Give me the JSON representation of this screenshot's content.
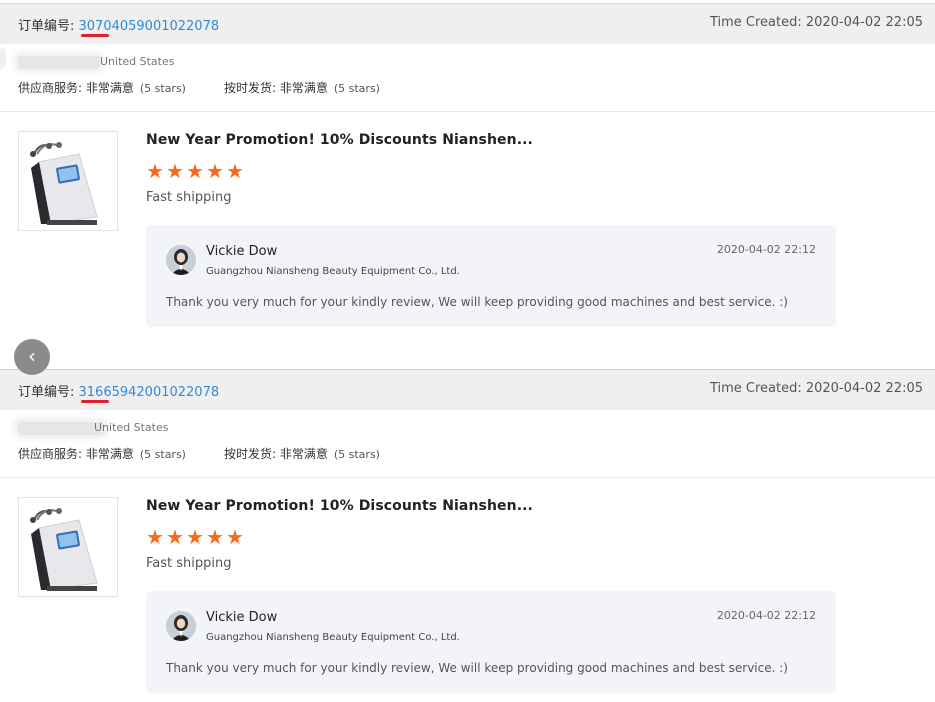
{
  "orders": [
    {
      "order_label": "订单编号: ",
      "order_number": "30704059001022078",
      "time_created": "Time Created: 2020-04-02 22:05",
      "buyer_country": "United States",
      "supplier_service_label": "供应商服务: 非常满意",
      "supplier_service_stars": "(5 stars)",
      "shipping_label": "按时发货: 非常满意",
      "shipping_stars": "(5 stars)",
      "product_title": "New Year Promotion! 10% Discounts Nianshen...",
      "rating_stars": 5,
      "review_text": "Fast shipping",
      "reply": {
        "name": "Vickie Dow",
        "company": "Guangzhou Niansheng Beauty Equipment Co., Ltd.",
        "time": "2020-04-02 22:12",
        "text": "Thank you very much for your kindly review, We will keep providing good machines and best service. :)"
      }
    },
    {
      "order_label": "订单编号: ",
      "order_number": "31665942001022078",
      "time_created": "Time Created: 2020-04-02 22:05",
      "buyer_country": "United States",
      "supplier_service_label": "供应商服务: 非常满意",
      "supplier_service_stars": "(5 stars)",
      "shipping_label": "按时发货: 非常满意",
      "shipping_stars": "(5 stars)",
      "product_title": "New Year Promotion! 10% Discounts Nianshen...",
      "rating_stars": 5,
      "review_text": "Fast shipping",
      "reply": {
        "name": "Vickie Dow",
        "company": "Guangzhou Niansheng Beauty Equipment Co., Ltd.",
        "time": "2020-04-02 22:12",
        "text": "Thank you very much for your kindly review, We will keep providing good machines and best service. :)"
      }
    }
  ],
  "colors": {
    "accent_link": "#2e8bd8",
    "star": "#f76a1b",
    "underline_mark": "#e0202a"
  },
  "icons": {
    "star": "star-icon",
    "carousel_prev": "chevron-left-icon"
  }
}
